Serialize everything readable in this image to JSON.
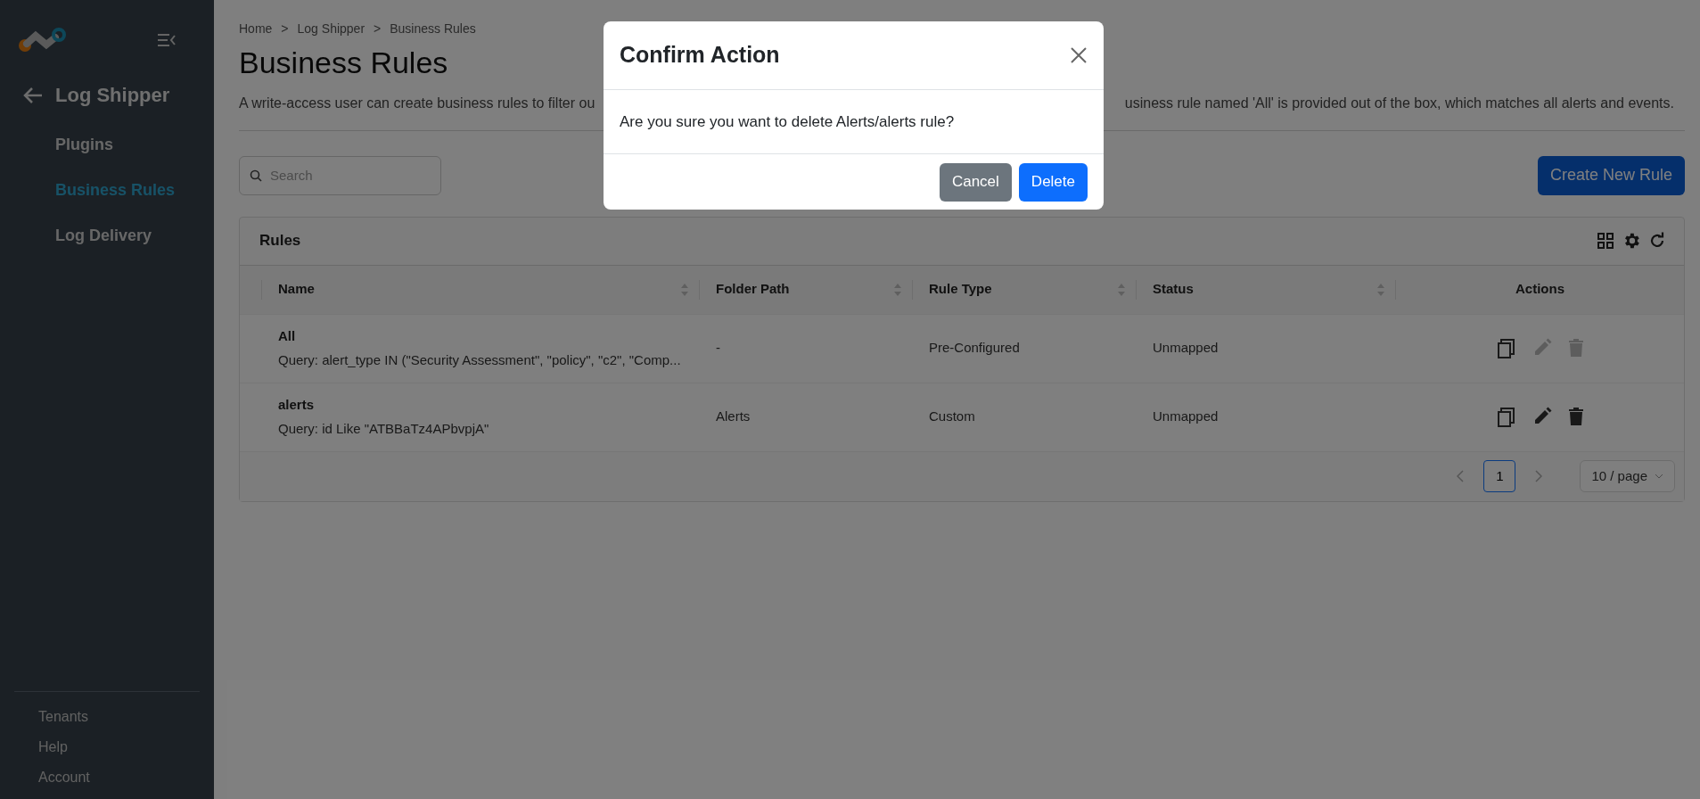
{
  "sidebar": {
    "back_title": "Log Shipper",
    "items": [
      {
        "label": "Plugins",
        "selected": false
      },
      {
        "label": "Business Rules",
        "selected": true
      },
      {
        "label": "Log Delivery",
        "selected": false
      }
    ],
    "footer_items": [
      "Tenants",
      "Help",
      "Account"
    ]
  },
  "breadcrumb": [
    "Home",
    "Log Shipper",
    "Business Rules"
  ],
  "breadcrumb_separator": ">",
  "page_title": "Business Rules",
  "description_visible_start": "A write-access user can create business rules to filter ou",
  "description_visible_end": "usiness rule named 'All' is provided out of the box, which matches all alerts and events.",
  "search": {
    "placeholder": "Search"
  },
  "create_button": "Create New Rule",
  "table": {
    "title": "Rules",
    "columns": [
      {
        "label": "Name",
        "sortable": true
      },
      {
        "label": "Folder Path",
        "sortable": true
      },
      {
        "label": "Rule Type",
        "sortable": true
      },
      {
        "label": "Status",
        "sortable": true
      },
      {
        "label": "Actions",
        "sortable": false
      }
    ],
    "rows": [
      {
        "name": "All",
        "query": "Query: alert_type IN (\"Security Assessment\", \"policy\", \"c2\", \"Comp...",
        "folder_path": "-",
        "rule_type": "Pre-Configured",
        "status": "Unmapped",
        "editable": false
      },
      {
        "name": "alerts",
        "query": "Query: id Like \"ATBBaTz4APbvpjA\"",
        "folder_path": "Alerts",
        "rule_type": "Custom",
        "status": "Unmapped",
        "editable": true
      }
    ],
    "pagination": {
      "pages": [
        {
          "label": "1",
          "selected": true
        }
      ],
      "page_size": "10 / page"
    }
  },
  "dialog": {
    "title": "Confirm Action",
    "message": "Are you sure you want to delete Alerts/alerts rule?",
    "buttons": [
      {
        "label": "Cancel",
        "kind": "secondary"
      },
      {
        "label": "Delete",
        "kind": "primary"
      }
    ]
  }
}
